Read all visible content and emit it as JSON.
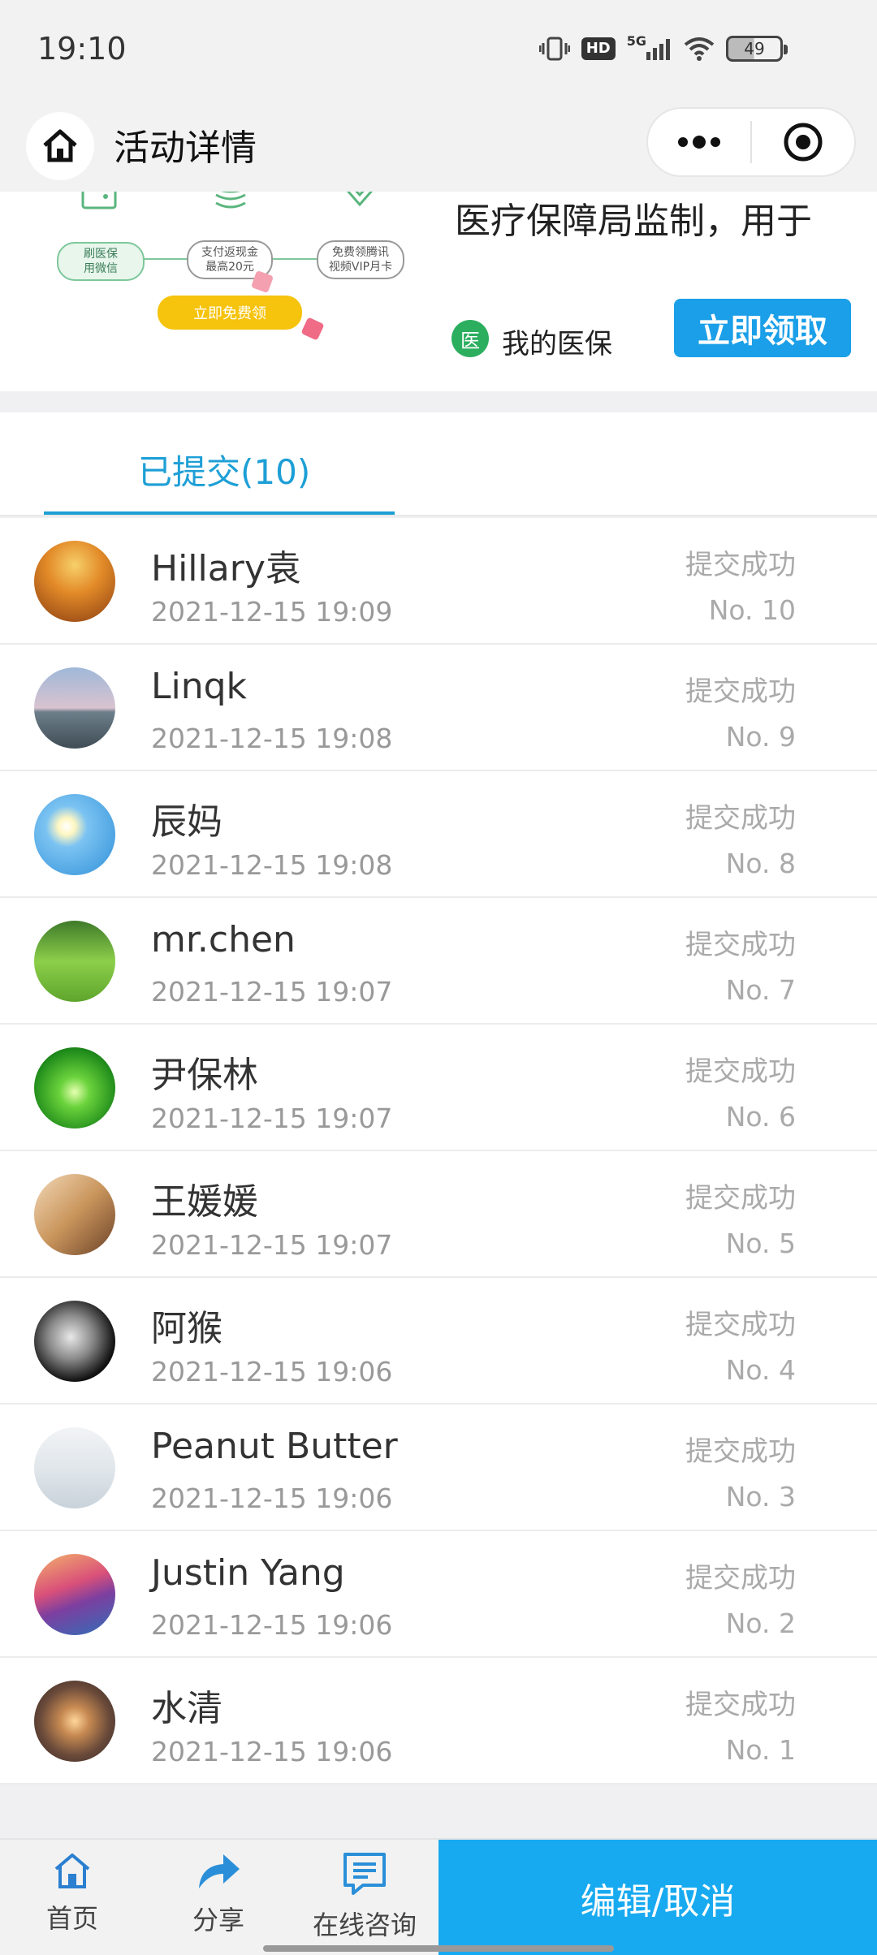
{
  "status_bar": {
    "time": "19:10",
    "network": "5G",
    "hd": "HD",
    "battery": "49"
  },
  "nav": {
    "title": "活动详情"
  },
  "banner": {
    "flow_steps": [
      "刷医保\n用微信",
      "支付返现金\n最高20元",
      "免费领腾讯\n视频VIP月卡"
    ],
    "free_button": "立即免费领",
    "headline": "医疗保障局监制，用于",
    "brand_logo": "医",
    "brand_name": "我的医保",
    "claim_button": "立即领取"
  },
  "tab": {
    "label": "已提交(10)"
  },
  "rows": [
    {
      "name": "Hillary袁",
      "time": "2021-12-15 19:09",
      "status": "提交成功",
      "no": "No. 10",
      "avatar": "autumn-sunset"
    },
    {
      "name": "Linqk",
      "time": "2021-12-15 19:08",
      "status": "提交成功",
      "no": "No. 9",
      "avatar": "lake-tree"
    },
    {
      "name": "辰妈",
      "time": "2021-12-15 19:08",
      "status": "提交成功",
      "no": "No. 8",
      "avatar": "daisy-sky"
    },
    {
      "name": "mr.chen",
      "time": "2021-12-15 19:07",
      "status": "提交成功",
      "no": "No. 7",
      "avatar": "sprout"
    },
    {
      "name": "尹保林",
      "time": "2021-12-15 19:07",
      "status": "提交成功",
      "no": "No. 6",
      "avatar": "forest-path"
    },
    {
      "name": "王媛媛",
      "time": "2021-12-15 19:07",
      "status": "提交成功",
      "no": "No. 5",
      "avatar": "person-bench"
    },
    {
      "name": "阿猴",
      "time": "2021-12-15 19:06",
      "status": "提交成功",
      "no": "No. 4",
      "avatar": "bw-portrait"
    },
    {
      "name": "Peanut Butter",
      "time": "2021-12-15 19:06",
      "status": "提交成功",
      "no": "No. 3",
      "avatar": "placeholder-mountain"
    },
    {
      "name": "Justin Yang",
      "time": "2021-12-15 19:06",
      "status": "提交成功",
      "no": "No. 2",
      "avatar": "coastal-village"
    },
    {
      "name": "水清",
      "time": "2021-12-15 19:06",
      "status": "提交成功",
      "no": "No. 1",
      "avatar": "sunset-water"
    }
  ],
  "bottom_bar": {
    "home": "首页",
    "share": "分享",
    "consult": "在线咨询",
    "edit": "编辑/取消"
  }
}
